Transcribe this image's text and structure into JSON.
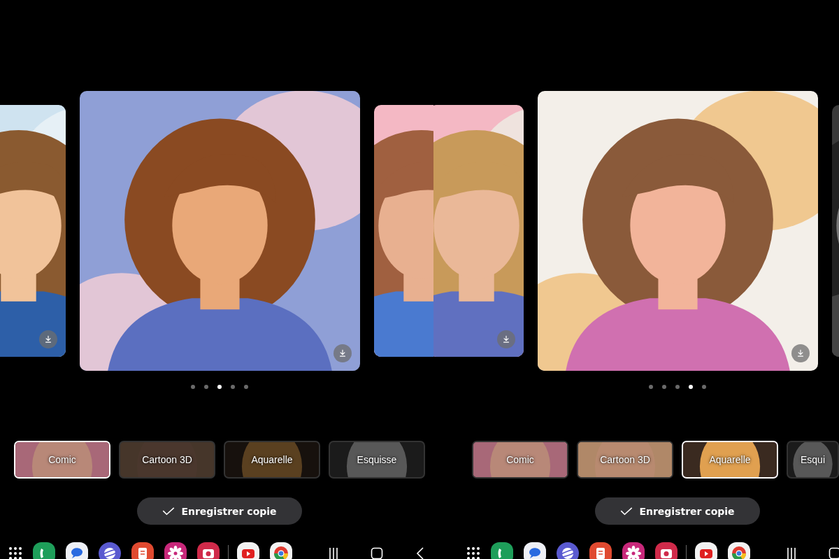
{
  "screens": [
    {
      "cards": [
        {
          "kind": "picture"
        },
        {
          "kind": "picture"
        },
        {
          "kind": "picture"
        }
      ],
      "page_dots": [
        {
          "selected": false
        },
        {
          "selected": false
        },
        {
          "selected": true
        },
        {
          "selected": false
        },
        {
          "selected": false
        }
      ],
      "styles": [
        {
          "label": "Comic",
          "selected": true,
          "dimmed": false
        },
        {
          "label": "Cartoon 3D",
          "selected": false,
          "dimmed": true
        },
        {
          "label": "Aquarelle",
          "selected": false,
          "dimmed": true
        },
        {
          "label": "Esquisse",
          "selected": false,
          "dimmed": true
        }
      ],
      "save_button": "Enregistrer copie"
    },
    {
      "cards": [
        {
          "kind": "picture"
        },
        {
          "kind": "picture"
        },
        {
          "kind": "picture"
        }
      ],
      "page_dots": [
        {
          "selected": false
        },
        {
          "selected": false
        },
        {
          "selected": false
        },
        {
          "selected": true
        },
        {
          "selected": false
        }
      ],
      "styles": [
        {
          "label": "Comic",
          "selected": false,
          "dimmed": false
        },
        {
          "label": "Cartoon 3D",
          "selected": false,
          "dimmed": false
        },
        {
          "label": "Aquarelle",
          "selected": true,
          "dimmed": false
        },
        {
          "label": "Esqui",
          "selected": false,
          "dimmed": true
        }
      ],
      "save_button": "Enregistrer copie"
    }
  ]
}
